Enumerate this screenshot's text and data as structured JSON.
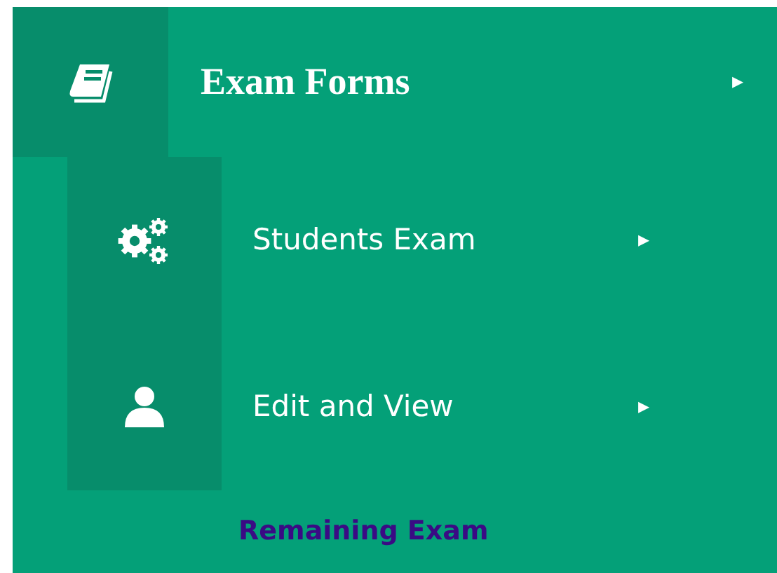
{
  "menu": {
    "title": "Exam Forms",
    "caret": "▸"
  },
  "submenu": [
    {
      "label": "Students Exam",
      "kind": "gears",
      "caret": "▸"
    },
    {
      "label": "Edit and View",
      "kind": "user",
      "caret": "▸"
    }
  ],
  "footer_link": "Remaining Exam"
}
